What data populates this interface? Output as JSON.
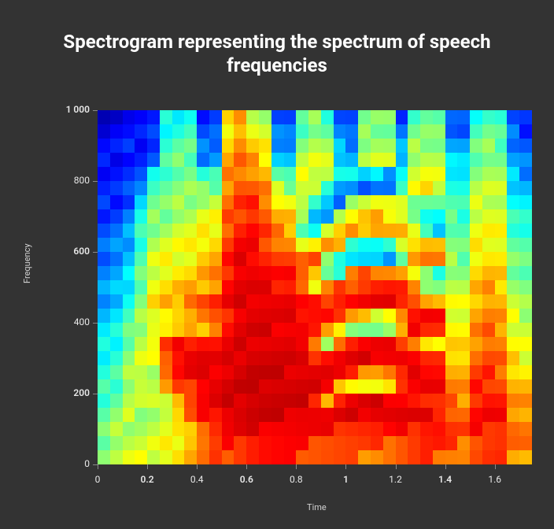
{
  "chart_data": {
    "type": "heatmap",
    "title": "Spectrogram representing the spectrum of speech frequencies",
    "xlabel": "Time",
    "ylabel": "Frequency",
    "x_ticks": [
      0,
      0.2,
      0.4,
      0.6,
      0.8,
      1,
      1.2,
      1.4,
      1.6
    ],
    "x_tick_labels": [
      "0",
      "0.2",
      "0.4",
      "0.6",
      "0.8",
      "1",
      "1.2",
      "1.4",
      "1.6"
    ],
    "y_ticks": [
      0,
      200,
      400,
      600,
      800,
      1000
    ],
    "y_tick_labels": [
      "0",
      "200",
      "400",
      "600",
      "800",
      "1 000"
    ],
    "xlim": [
      0,
      1.75
    ],
    "ylim": [
      0,
      1000
    ],
    "note": "Heatmap cell values approximate spectral intensity on a 0–1 scale (0=cool/blue, 1=hot/red) estimated from the image. Grid is 35 cols × 25 rows (time × frequency).",
    "nx": 35,
    "ny": 25,
    "values_row_major_top_to_bottom": [
      [
        0.1,
        0.1,
        0.12,
        0.12,
        0.13,
        0.38,
        0.4,
        0.42,
        0.15,
        0.18,
        0.65,
        0.7,
        0.6,
        0.55,
        0.2,
        0.18,
        0.45,
        0.5,
        0.45,
        0.22,
        0.2,
        0.48,
        0.5,
        0.48,
        0.2,
        0.45,
        0.48,
        0.45,
        0.2,
        0.18,
        0.42,
        0.45,
        0.42,
        0.18,
        0.15
      ],
      [
        0.1,
        0.12,
        0.12,
        0.13,
        0.15,
        0.4,
        0.42,
        0.44,
        0.18,
        0.2,
        0.66,
        0.72,
        0.62,
        0.58,
        0.25,
        0.22,
        0.48,
        0.52,
        0.48,
        0.25,
        0.22,
        0.5,
        0.52,
        0.5,
        0.25,
        0.48,
        0.5,
        0.48,
        0.25,
        0.22,
        0.45,
        0.48,
        0.45,
        0.22,
        0.18
      ],
      [
        0.12,
        0.13,
        0.14,
        0.15,
        0.18,
        0.42,
        0.45,
        0.46,
        0.22,
        0.25,
        0.68,
        0.74,
        0.66,
        0.62,
        0.3,
        0.28,
        0.52,
        0.55,
        0.52,
        0.3,
        0.28,
        0.53,
        0.55,
        0.53,
        0.3,
        0.52,
        0.54,
        0.52,
        0.3,
        0.28,
        0.48,
        0.5,
        0.48,
        0.25,
        0.22
      ],
      [
        0.12,
        0.14,
        0.15,
        0.16,
        0.2,
        0.44,
        0.47,
        0.48,
        0.25,
        0.28,
        0.7,
        0.76,
        0.7,
        0.66,
        0.35,
        0.32,
        0.55,
        0.58,
        0.55,
        0.35,
        0.32,
        0.56,
        0.58,
        0.56,
        0.35,
        0.55,
        0.57,
        0.55,
        0.35,
        0.32,
        0.5,
        0.52,
        0.5,
        0.28,
        0.25
      ],
      [
        0.14,
        0.15,
        0.16,
        0.18,
        0.35,
        0.46,
        0.48,
        0.5,
        0.4,
        0.42,
        0.72,
        0.78,
        0.74,
        0.7,
        0.45,
        0.42,
        0.58,
        0.6,
        0.58,
        0.4,
        0.38,
        0.3,
        0.32,
        0.3,
        0.4,
        0.58,
        0.6,
        0.58,
        0.4,
        0.38,
        0.52,
        0.54,
        0.52,
        0.32,
        0.28
      ],
      [
        0.15,
        0.16,
        0.18,
        0.3,
        0.46,
        0.48,
        0.5,
        0.52,
        0.48,
        0.5,
        0.74,
        0.8,
        0.78,
        0.74,
        0.55,
        0.52,
        0.6,
        0.58,
        0.4,
        0.25,
        0.22,
        0.24,
        0.26,
        0.24,
        0.42,
        0.6,
        0.62,
        0.6,
        0.42,
        0.4,
        0.54,
        0.56,
        0.54,
        0.35,
        0.32
      ],
      [
        0.16,
        0.18,
        0.2,
        0.35,
        0.48,
        0.5,
        0.52,
        0.54,
        0.55,
        0.58,
        0.76,
        0.82,
        0.82,
        0.78,
        0.65,
        0.62,
        0.55,
        0.4,
        0.28,
        0.26,
        0.55,
        0.58,
        0.6,
        0.58,
        0.55,
        0.52,
        0.5,
        0.48,
        0.44,
        0.42,
        0.56,
        0.58,
        0.56,
        0.38,
        0.35
      ],
      [
        0.18,
        0.2,
        0.25,
        0.38,
        0.5,
        0.52,
        0.55,
        0.56,
        0.6,
        0.62,
        0.78,
        0.84,
        0.85,
        0.8,
        0.7,
        0.68,
        0.5,
        0.35,
        0.3,
        0.56,
        0.62,
        0.66,
        0.68,
        0.66,
        0.62,
        0.5,
        0.38,
        0.35,
        0.45,
        0.44,
        0.58,
        0.6,
        0.58,
        0.42,
        0.38
      ],
      [
        0.2,
        0.22,
        0.28,
        0.4,
        0.52,
        0.55,
        0.58,
        0.58,
        0.62,
        0.65,
        0.8,
        0.86,
        0.87,
        0.82,
        0.74,
        0.72,
        0.48,
        0.4,
        0.58,
        0.65,
        0.7,
        0.72,
        0.74,
        0.72,
        0.7,
        0.58,
        0.4,
        0.36,
        0.48,
        0.46,
        0.6,
        0.62,
        0.6,
        0.45,
        0.42
      ],
      [
        0.22,
        0.24,
        0.3,
        0.42,
        0.55,
        0.58,
        0.6,
        0.6,
        0.65,
        0.68,
        0.82,
        0.88,
        0.88,
        0.84,
        0.78,
        0.76,
        0.6,
        0.62,
        0.7,
        0.75,
        0.45,
        0.4,
        0.38,
        0.4,
        0.55,
        0.7,
        0.72,
        0.7,
        0.5,
        0.48,
        0.62,
        0.64,
        0.62,
        0.48,
        0.45
      ],
      [
        0.24,
        0.26,
        0.32,
        0.44,
        0.58,
        0.6,
        0.62,
        0.62,
        0.68,
        0.7,
        0.84,
        0.9,
        0.9,
        0.86,
        0.82,
        0.8,
        0.75,
        0.76,
        0.55,
        0.42,
        0.35,
        0.32,
        0.3,
        0.32,
        0.5,
        0.74,
        0.76,
        0.74,
        0.52,
        0.5,
        0.64,
        0.66,
        0.64,
        0.5,
        0.46
      ],
      [
        0.26,
        0.28,
        0.35,
        0.46,
        0.6,
        0.62,
        0.65,
        0.65,
        0.7,
        0.72,
        0.86,
        0.91,
        0.91,
        0.88,
        0.85,
        0.84,
        0.82,
        0.7,
        0.48,
        0.4,
        0.72,
        0.76,
        0.78,
        0.76,
        0.72,
        0.6,
        0.48,
        0.45,
        0.54,
        0.52,
        0.66,
        0.68,
        0.66,
        0.52,
        0.48
      ],
      [
        0.28,
        0.3,
        0.38,
        0.48,
        0.62,
        0.65,
        0.68,
        0.68,
        0.72,
        0.74,
        0.88,
        0.92,
        0.92,
        0.9,
        0.88,
        0.87,
        0.78,
        0.6,
        0.72,
        0.78,
        0.82,
        0.84,
        0.85,
        0.84,
        0.82,
        0.7,
        0.55,
        0.52,
        0.56,
        0.54,
        0.68,
        0.7,
        0.68,
        0.54,
        0.5
      ],
      [
        0.3,
        0.32,
        0.4,
        0.5,
        0.65,
        0.68,
        0.72,
        0.8,
        0.82,
        0.84,
        0.9,
        0.93,
        0.94,
        0.93,
        0.92,
        0.91,
        0.85,
        0.82,
        0.85,
        0.87,
        0.88,
        0.89,
        0.9,
        0.89,
        0.88,
        0.82,
        0.72,
        0.68,
        0.6,
        0.58,
        0.7,
        0.72,
        0.7,
        0.56,
        0.52
      ],
      [
        0.32,
        0.35,
        0.42,
        0.52,
        0.64,
        0.66,
        0.68,
        0.7,
        0.74,
        0.76,
        0.87,
        0.92,
        0.94,
        0.93,
        0.92,
        0.91,
        0.9,
        0.89,
        0.88,
        0.82,
        0.7,
        0.65,
        0.62,
        0.65,
        0.75,
        0.85,
        0.87,
        0.85,
        0.62,
        0.6,
        0.72,
        0.74,
        0.72,
        0.58,
        0.55
      ],
      [
        0.34,
        0.38,
        0.45,
        0.54,
        0.62,
        0.64,
        0.66,
        0.68,
        0.72,
        0.78,
        0.88,
        0.93,
        0.95,
        0.94,
        0.93,
        0.92,
        0.91,
        0.85,
        0.7,
        0.6,
        0.55,
        0.52,
        0.5,
        0.52,
        0.68,
        0.86,
        0.88,
        0.86,
        0.64,
        0.62,
        0.74,
        0.76,
        0.74,
        0.6,
        0.58
      ],
      [
        0.36,
        0.4,
        0.48,
        0.56,
        0.6,
        0.8,
        0.85,
        0.88,
        0.88,
        0.86,
        0.9,
        0.94,
        0.96,
        0.95,
        0.94,
        0.93,
        0.88,
        0.72,
        0.58,
        0.8,
        0.86,
        0.88,
        0.89,
        0.88,
        0.86,
        0.78,
        0.66,
        0.62,
        0.66,
        0.64,
        0.76,
        0.78,
        0.76,
        0.62,
        0.6
      ],
      [
        0.38,
        0.42,
        0.5,
        0.58,
        0.58,
        0.82,
        0.88,
        0.92,
        0.92,
        0.9,
        0.91,
        0.95,
        0.97,
        0.96,
        0.95,
        0.94,
        0.9,
        0.86,
        0.88,
        0.9,
        0.92,
        0.93,
        0.94,
        0.93,
        0.92,
        0.88,
        0.82,
        0.8,
        0.7,
        0.68,
        0.78,
        0.8,
        0.78,
        0.65,
        0.62
      ],
      [
        0.4,
        0.44,
        0.52,
        0.6,
        0.55,
        0.78,
        0.86,
        0.9,
        0.9,
        0.92,
        0.93,
        0.96,
        0.98,
        0.97,
        0.96,
        0.95,
        0.94,
        0.93,
        0.92,
        0.88,
        0.8,
        0.76,
        0.74,
        0.76,
        0.82,
        0.9,
        0.92,
        0.9,
        0.72,
        0.7,
        0.8,
        0.82,
        0.8,
        0.68,
        0.65
      ],
      [
        0.42,
        0.46,
        0.54,
        0.58,
        0.55,
        0.7,
        0.78,
        0.85,
        0.9,
        0.93,
        0.95,
        0.97,
        0.98,
        0.98,
        0.97,
        0.96,
        0.95,
        0.94,
        0.85,
        0.72,
        0.65,
        0.62,
        0.6,
        0.62,
        0.78,
        0.92,
        0.94,
        0.92,
        0.74,
        0.72,
        0.82,
        0.84,
        0.82,
        0.7,
        0.68
      ],
      [
        0.44,
        0.48,
        0.55,
        0.56,
        0.55,
        0.62,
        0.72,
        0.82,
        0.88,
        0.92,
        0.95,
        0.97,
        0.98,
        0.98,
        0.97,
        0.96,
        0.95,
        0.88,
        0.72,
        0.85,
        0.9,
        0.92,
        0.93,
        0.92,
        0.9,
        0.86,
        0.82,
        0.8,
        0.76,
        0.74,
        0.84,
        0.86,
        0.84,
        0.72,
        0.7
      ],
      [
        0.46,
        0.5,
        0.56,
        0.55,
        0.55,
        0.58,
        0.66,
        0.78,
        0.85,
        0.9,
        0.94,
        0.96,
        0.97,
        0.97,
        0.96,
        0.95,
        0.94,
        0.92,
        0.9,
        0.92,
        0.93,
        0.94,
        0.95,
        0.94,
        0.93,
        0.92,
        0.9,
        0.88,
        0.8,
        0.78,
        0.86,
        0.88,
        0.86,
        0.75,
        0.72
      ],
      [
        0.48,
        0.52,
        0.55,
        0.55,
        0.56,
        0.58,
        0.62,
        0.72,
        0.8,
        0.85,
        0.9,
        0.92,
        0.93,
        0.93,
        0.92,
        0.91,
        0.9,
        0.89,
        0.88,
        0.87,
        0.86,
        0.85,
        0.84,
        0.85,
        0.86,
        0.87,
        0.88,
        0.87,
        0.82,
        0.8,
        0.85,
        0.86,
        0.85,
        0.78,
        0.75
      ],
      [
        0.5,
        0.54,
        0.56,
        0.56,
        0.58,
        0.6,
        0.64,
        0.7,
        0.76,
        0.8,
        0.85,
        0.87,
        0.88,
        0.88,
        0.87,
        0.86,
        0.85,
        0.84,
        0.83,
        0.82,
        0.81,
        0.8,
        0.8,
        0.81,
        0.82,
        0.83,
        0.84,
        0.83,
        0.8,
        0.78,
        0.82,
        0.83,
        0.82,
        0.76,
        0.74
      ],
      [
        0.52,
        0.55,
        0.58,
        0.58,
        0.6,
        0.62,
        0.66,
        0.7,
        0.74,
        0.78,
        0.82,
        0.84,
        0.85,
        0.85,
        0.84,
        0.83,
        0.82,
        0.81,
        0.8,
        0.79,
        0.78,
        0.77,
        0.77,
        0.78,
        0.79,
        0.8,
        0.81,
        0.8,
        0.78,
        0.76,
        0.8,
        0.81,
        0.8,
        0.75,
        0.72
      ]
    ],
    "colorscale_note": "jet-like: blue→cyan→green→yellow→orange→red"
  },
  "colors": {
    "bg": "#333333",
    "text": "#ffffff",
    "axis": "#d0d0d0"
  }
}
